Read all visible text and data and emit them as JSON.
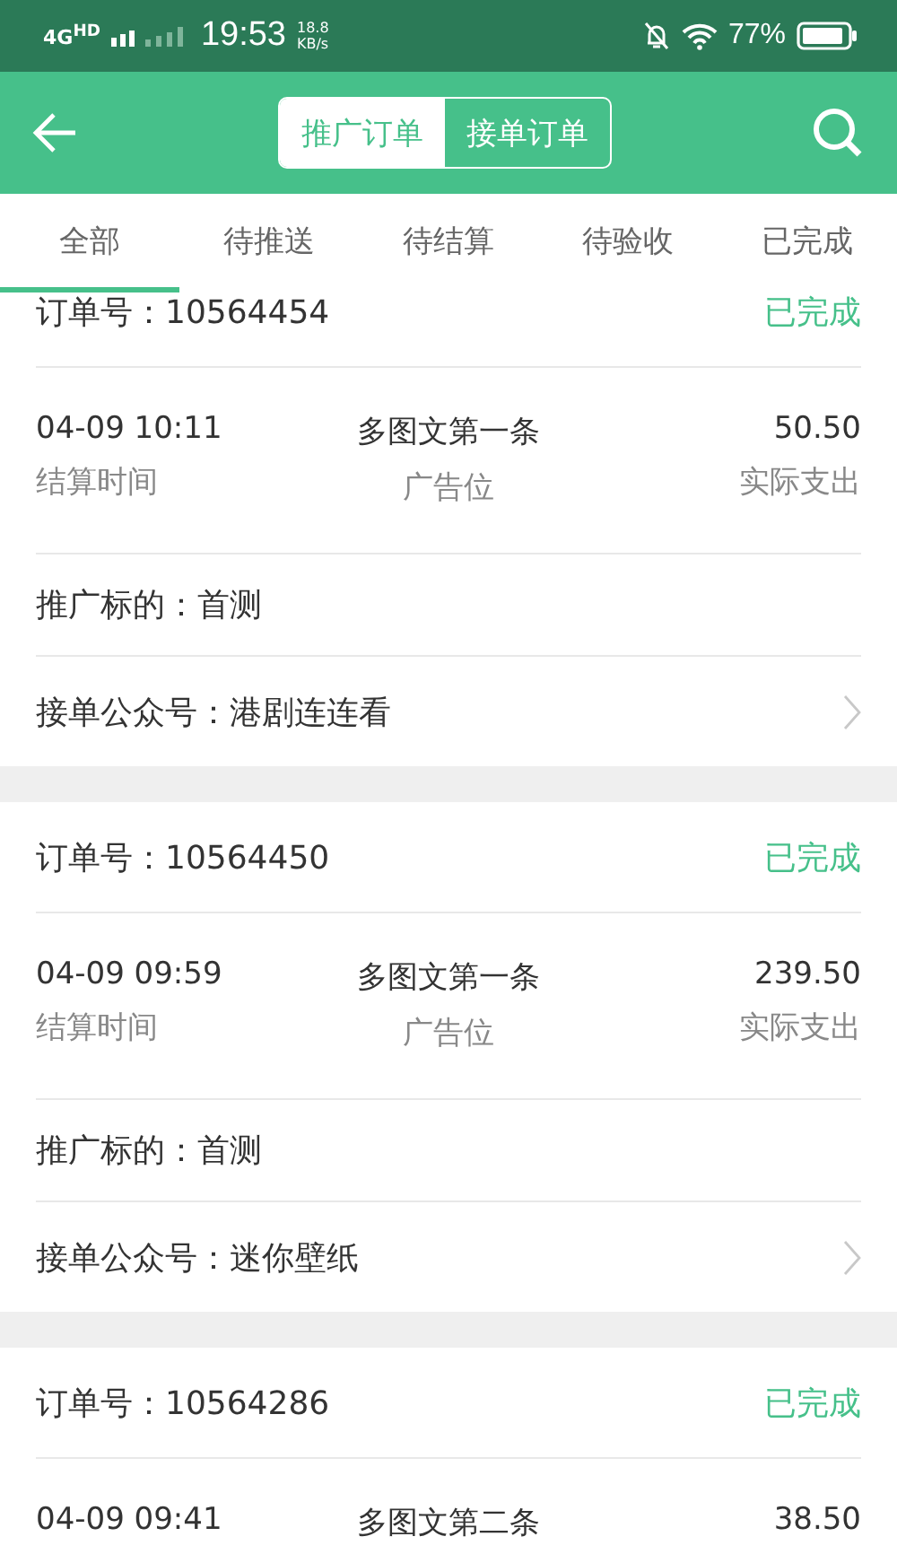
{
  "status_bar": {
    "network": "4G$^{HD}$",
    "time": "19:53",
    "speed_value": "18.8",
    "speed_unit": "KB/s",
    "battery": "77%"
  },
  "header": {
    "segments": [
      {
        "label": "推广订单",
        "selected": true
      },
      {
        "label": "接单订单",
        "selected": false
      }
    ]
  },
  "tabs": [
    {
      "label": "全部",
      "selected": true
    },
    {
      "label": "待推送",
      "selected": false
    },
    {
      "label": "待结算",
      "selected": false
    },
    {
      "label": "待验收",
      "selected": false
    },
    {
      "label": "已完成",
      "selected": false
    }
  ],
  "orders": [
    {
      "order_label": "订单号：",
      "order_no": "10564454",
      "status": "已完成",
      "time": "04-09 10:11",
      "time_label": "结算时间",
      "position": "多图文第一条",
      "position_label": "广告位",
      "amount": "50.50",
      "amount_label": "实际支出",
      "target_label": "推广标的：",
      "target": "首测",
      "account_label": "接单公众号：",
      "account": "港剧连连看"
    },
    {
      "order_label": "订单号：",
      "order_no": "10564450",
      "status": "已完成",
      "time": "04-09 09:59",
      "time_label": "结算时间",
      "position": "多图文第一条",
      "position_label": "广告位",
      "amount": "239.50",
      "amount_label": "实际支出",
      "target_label": "推广标的：",
      "target": "首测",
      "account_label": "接单公众号：",
      "account": "迷你壁纸"
    },
    {
      "order_label": "订单号：",
      "order_no": "10564286",
      "status": "已完成",
      "time": "04-09 09:41",
      "position": "多图文第二条",
      "amount": "38.50"
    }
  ]
}
